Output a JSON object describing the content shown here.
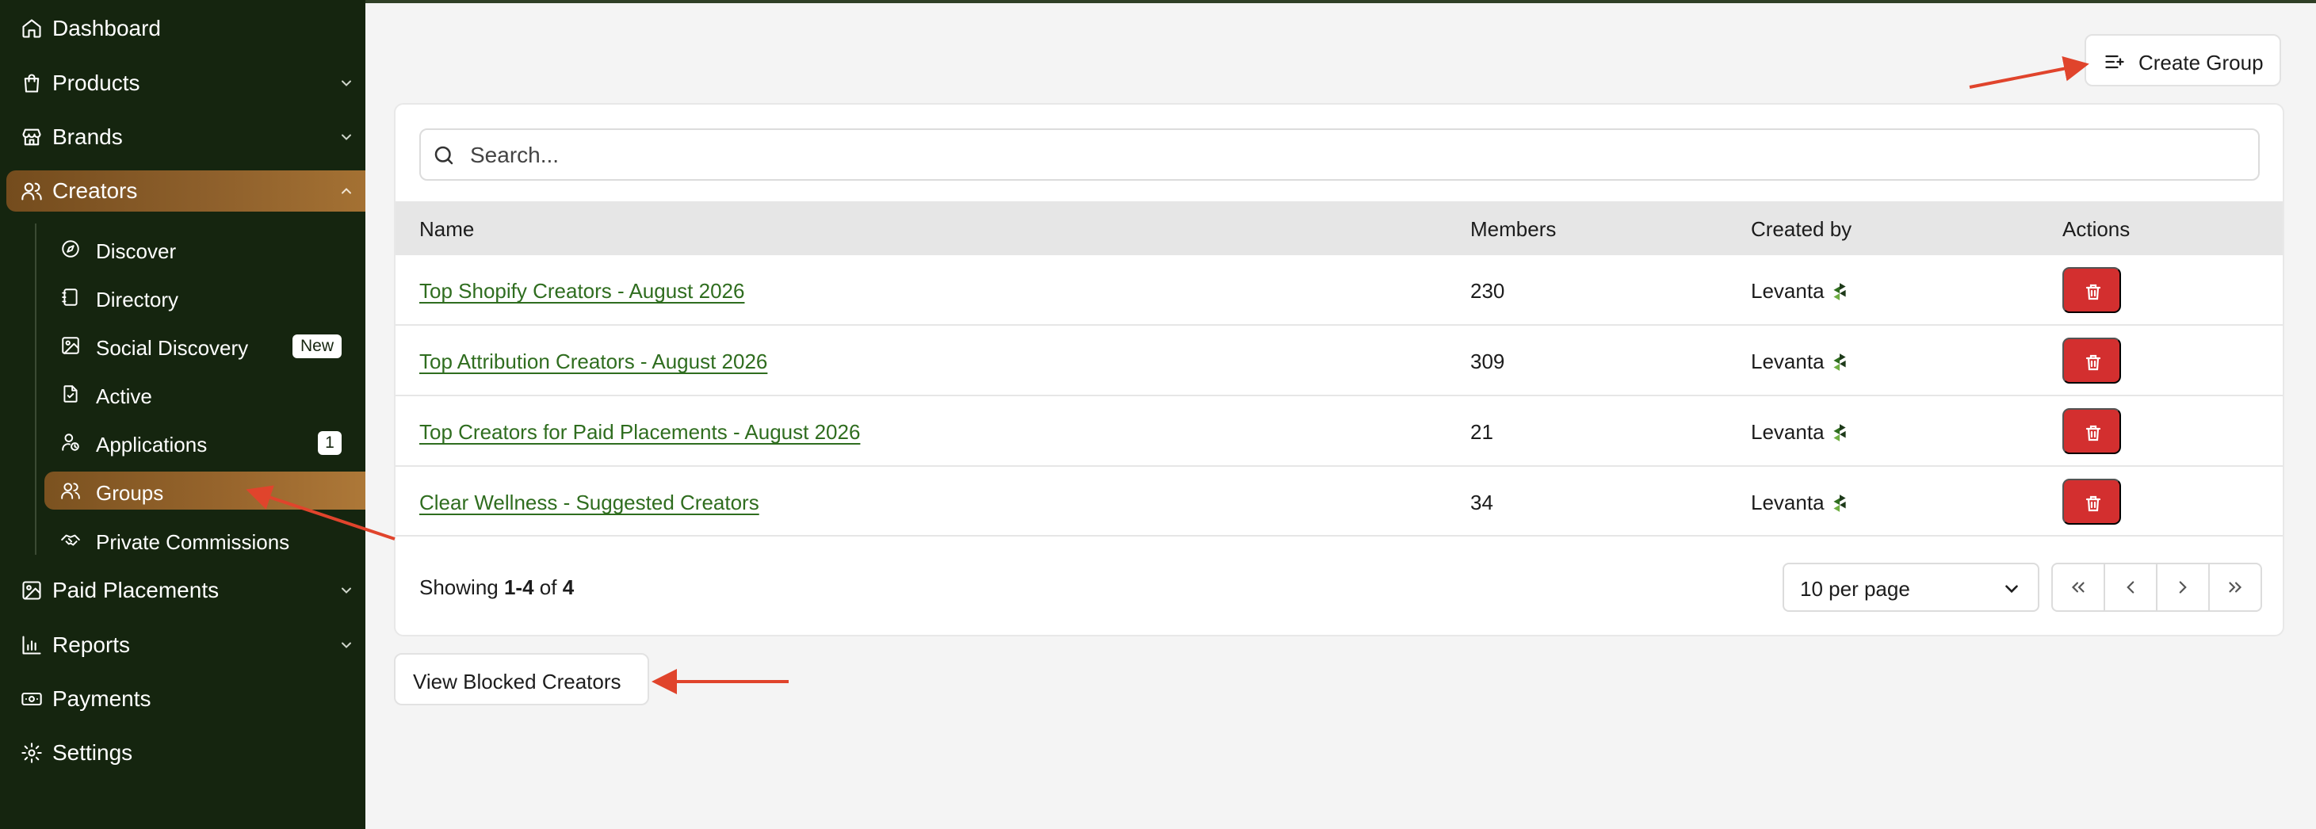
{
  "sidebar": {
    "items": [
      {
        "label": "Dashboard",
        "icon": "home-icon"
      },
      {
        "label": "Products",
        "icon": "shopping-bag-icon",
        "expandable": true
      },
      {
        "label": "Brands",
        "icon": "store-icon",
        "expandable": true
      },
      {
        "label": "Creators",
        "icon": "users-icon",
        "expandable": true,
        "expanded": true,
        "active": true
      },
      {
        "label": "Paid Placements",
        "icon": "image-icon",
        "expandable": true
      },
      {
        "label": "Reports",
        "icon": "bar-chart-icon",
        "expandable": true
      },
      {
        "label": "Payments",
        "icon": "banknote-icon"
      },
      {
        "label": "Settings",
        "icon": "gear-icon"
      }
    ],
    "creators_sub": [
      {
        "label": "Discover",
        "icon": "compass-icon"
      },
      {
        "label": "Directory",
        "icon": "notebook-icon"
      },
      {
        "label": "Social Discovery",
        "icon": "image-icon",
        "badge": "New"
      },
      {
        "label": "Active",
        "icon": "file-check-icon"
      },
      {
        "label": "Applications",
        "icon": "user-clock-icon",
        "badge": "1"
      },
      {
        "label": "Groups",
        "icon": "users-icon",
        "active": true
      },
      {
        "label": "Private Commissions",
        "icon": "handshake-icon"
      }
    ]
  },
  "toolbar": {
    "create_group_label": "Create Group",
    "create_group_icon": "list-plus-icon"
  },
  "search": {
    "placeholder": "Search...",
    "value": ""
  },
  "table": {
    "columns": [
      "Name",
      "Members",
      "Created by",
      "Actions"
    ],
    "rows": [
      {
        "name": "Top Shopify Creators - August 2026",
        "members": "230",
        "created_by": "Levanta"
      },
      {
        "name": "Top Attribution Creators - August 2026",
        "members": "309",
        "created_by": "Levanta"
      },
      {
        "name": "Top Creators for Paid Placements - August 2026",
        "members": "21",
        "created_by": "Levanta"
      },
      {
        "name": "Clear Wellness - Suggested Creators",
        "members": "34",
        "created_by": "Levanta"
      }
    ]
  },
  "pagination": {
    "showing_prefix": "Showing",
    "range": "1-4",
    "of_word": "of",
    "total": "4",
    "per_page": "10 per page"
  },
  "blocked": {
    "label": "View Blocked Creators"
  },
  "colors": {
    "sidebar_bg": "#15250f",
    "active_item": "#8d5f2b",
    "link": "#2f6d1f",
    "delete": "#d32f2f",
    "annotation_arrow": "#e0442c"
  }
}
